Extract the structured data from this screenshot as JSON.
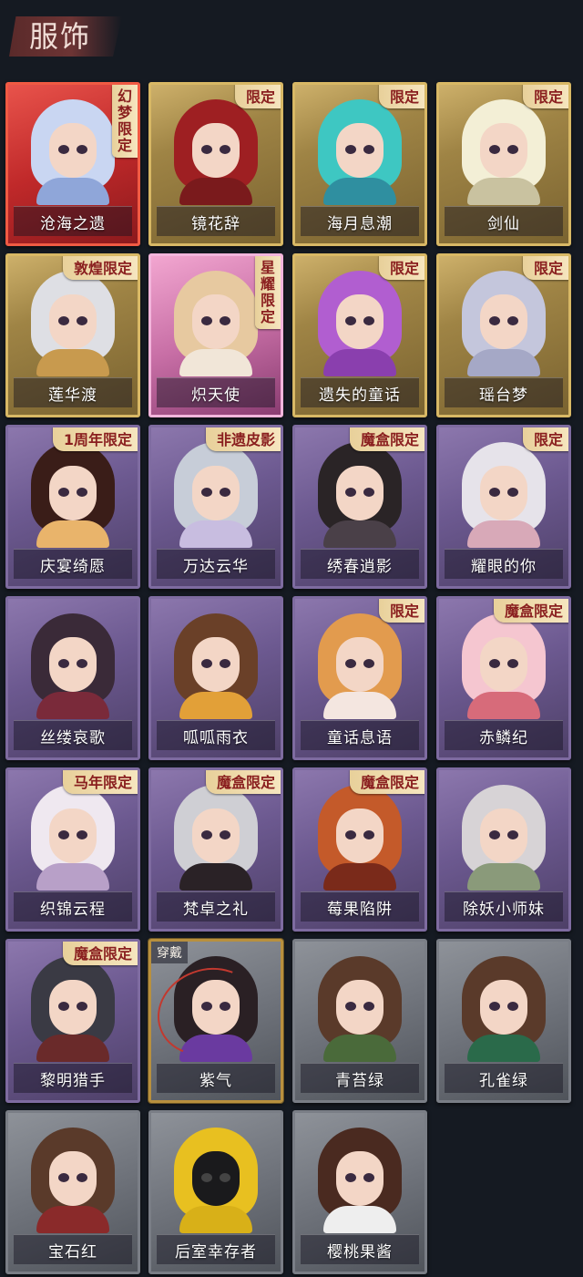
{
  "header": {
    "title": "服饰"
  },
  "cards": [
    {
      "name": "沧海之遗",
      "frame": "red",
      "badge": "幻梦限定",
      "badge_style": "vertical",
      "hair": "#c9d6f2",
      "body": "#8fa6d9"
    },
    {
      "name": "镜花辞",
      "frame": "gold",
      "badge": "限定",
      "badge_style": "normal",
      "hair": "#9e1f22",
      "body": "#7a1a1c"
    },
    {
      "name": "海月息潮",
      "frame": "gold",
      "badge": "限定",
      "badge_style": "normal",
      "hair": "#3ec7c2",
      "body": "#2f8fa0"
    },
    {
      "name": "剑仙",
      "frame": "gold",
      "badge": "限定",
      "badge_style": "normal",
      "hair": "#f3efd6",
      "body": "#c9c2a0"
    },
    {
      "name": "莲华渡",
      "frame": "gold",
      "badge": "敦煌限定",
      "badge_style": "normal",
      "hair": "#dedfe4",
      "body": "#c89a4e"
    },
    {
      "name": "炽天使",
      "frame": "pink",
      "badge": "星耀限定",
      "badge_style": "vertical",
      "hair": "#e7c9a0",
      "body": "#f1e6d8"
    },
    {
      "name": "遗失的童话",
      "frame": "gold",
      "badge": "限定",
      "badge_style": "normal",
      "hair": "#b15ed0",
      "body": "#8a3fae"
    },
    {
      "name": "瑶台梦",
      "frame": "gold",
      "badge": "限定",
      "badge_style": "normal",
      "hair": "#c4c6dc",
      "body": "#a5a8c6"
    },
    {
      "name": "庆宴绮愿",
      "frame": "purple",
      "badge": "1周年限定",
      "badge_style": "normal",
      "hair": "#3a1d18",
      "body": "#e9b46b"
    },
    {
      "name": "万达云华",
      "frame": "purple",
      "badge": "非遗皮影",
      "badge_style": "normal",
      "hair": "#c7cdd8",
      "body": "#c8bde0"
    },
    {
      "name": "绣春逍影",
      "frame": "purple",
      "badge": "魔盒限定",
      "badge_style": "normal",
      "hair": "#2a2426",
      "body": "#4a4048"
    },
    {
      "name": "耀眼的你",
      "frame": "purple",
      "badge": "限定",
      "badge_style": "normal",
      "hair": "#e6e3ea",
      "body": "#d8a9b8"
    },
    {
      "name": "丝缕哀歌",
      "frame": "purple",
      "badge": "",
      "badge_style": "normal",
      "hair": "#3a2a38",
      "body": "#7a2a3a"
    },
    {
      "name": "呱呱雨衣",
      "frame": "purple",
      "badge": "",
      "badge_style": "normal",
      "hair": "#6a4028",
      "body": "#e2a038"
    },
    {
      "name": "童话息语",
      "frame": "purple",
      "badge": "限定",
      "badge_style": "normal",
      "hair": "#e29b4e",
      "body": "#f4e6e0"
    },
    {
      "name": "赤鳞纪",
      "frame": "purple",
      "badge": "魔盒限定",
      "badge_style": "normal",
      "hair": "#f5c6d0",
      "body": "#d76b7a"
    },
    {
      "name": "织锦云程",
      "frame": "purple",
      "badge": "马年限定",
      "badge_style": "normal",
      "hair": "#efe8f0",
      "body": "#b8a0c8"
    },
    {
      "name": "梵卓之礼",
      "frame": "purple",
      "badge": "魔盒限定",
      "badge_style": "normal",
      "hair": "#cfcfd4",
      "body": "#2a2226"
    },
    {
      "name": "莓果陷阱",
      "frame": "purple",
      "badge": "魔盒限定",
      "badge_style": "normal",
      "hair": "#c45a2a",
      "body": "#7a2a1a"
    },
    {
      "name": "除妖小师妹",
      "frame": "purple",
      "badge": "",
      "badge_style": "normal",
      "hair": "#d7d3d6",
      "body": "#8a9a7a"
    },
    {
      "name": "黎明猎手",
      "frame": "purple",
      "badge": "魔盒限定",
      "badge_style": "normal",
      "hair": "#3a3a44",
      "body": "#6a2a2a"
    },
    {
      "name": "紫气",
      "frame": "grey",
      "badge": "",
      "badge_style": "normal",
      "hair": "#2a2024",
      "body": "#6a3aa0",
      "equipped": "穿戴"
    },
    {
      "name": "青苔绿",
      "frame": "grey",
      "badge": "",
      "badge_style": "normal",
      "hair": "#5a3a2a",
      "body": "#4a6a3a"
    },
    {
      "name": "孔雀绿",
      "frame": "grey",
      "badge": "",
      "badge_style": "normal",
      "hair": "#5a3a2a",
      "body": "#2a6a4a"
    },
    {
      "name": "宝石红",
      "frame": "grey",
      "badge": "",
      "badge_style": "normal",
      "hair": "#5a3a2a",
      "body": "#8a2a2a"
    },
    {
      "name": "后室幸存者",
      "frame": "grey",
      "badge": "",
      "badge_style": "normal",
      "hair": "#e8c020",
      "body": "#d8b018",
      "hazmat": true
    },
    {
      "name": "樱桃果酱",
      "frame": "grey",
      "badge": "",
      "badge_style": "normal",
      "hair": "#4a2a20",
      "body": "#eeeeee"
    }
  ]
}
